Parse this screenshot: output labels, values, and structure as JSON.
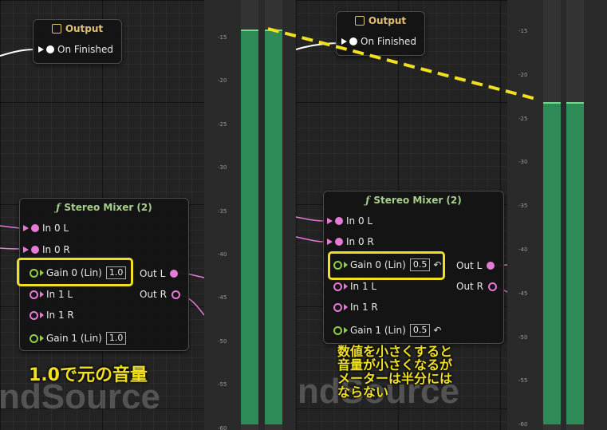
{
  "panels": [
    {
      "output_node": {
        "title": "Output",
        "pin_label": "On Finished"
      },
      "mixer_node": {
        "title": "Stereo Mixer (2)",
        "inputs": [
          {
            "label": "In 0 L"
          },
          {
            "label": "In 0 R"
          },
          {
            "label": "Gain 0 (Lin)",
            "value": "1.0"
          },
          {
            "label": "In 1 L"
          },
          {
            "label": "In 1 R"
          },
          {
            "label": "Gain 1 (Lin)",
            "value": "1.0"
          }
        ],
        "outputs": [
          {
            "label": "Out L"
          },
          {
            "label": "Out R"
          }
        ]
      },
      "meter_ticks": [
        "-15",
        "-20",
        "-25",
        "-30",
        "-35",
        "-40",
        "-45",
        "-50",
        "-55",
        "-60"
      ],
      "meter_level_db": -14,
      "watermark": "ndSource",
      "caption": "1.0で元の音量"
    },
    {
      "output_node": {
        "title": "Output",
        "pin_label": "On Finished"
      },
      "mixer_node": {
        "title": "Stereo Mixer (2)",
        "inputs": [
          {
            "label": "In 0 L"
          },
          {
            "label": "In 0 R"
          },
          {
            "label": "Gain 0 (Lin)",
            "value": "0.5"
          },
          {
            "label": "In 1 L"
          },
          {
            "label": "In 1 R"
          },
          {
            "label": "Gain 1 (Lin)",
            "value": "0.5"
          }
        ],
        "outputs": [
          {
            "label": "Out L"
          },
          {
            "label": "Out R"
          }
        ]
      },
      "meter_ticks": [
        "-15",
        "-20",
        "-25",
        "-30",
        "-35",
        "-40",
        "-45",
        "-50",
        "-55",
        "-60"
      ],
      "meter_level_db": -23,
      "watermark": "ndSource",
      "caption_lines": [
        "数値を小さくすると",
        "音量が小さくなるが",
        "メーターは半分には",
        "ならない"
      ]
    }
  ],
  "colors": {
    "highlight": "#f0e020",
    "meter_fill": "#2e8b57",
    "audio_pin": "#e67bd7",
    "float_pin": "#8fce4a"
  }
}
